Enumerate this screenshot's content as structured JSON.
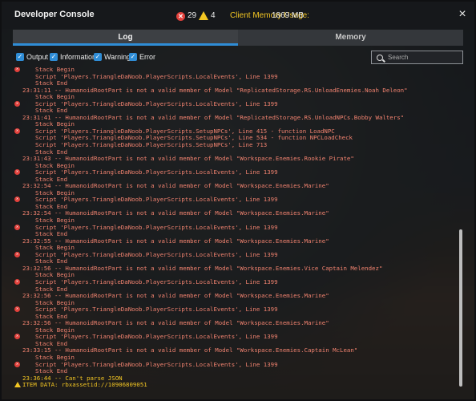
{
  "window": {
    "title": "Developer Console",
    "error_count": "29",
    "warning_count": "4",
    "memory_label": "Client Memory Usage:",
    "memory_value": "1869 MB",
    "close_glyph": "×"
  },
  "tabs": [
    {
      "label": "Log",
      "active": true
    },
    {
      "label": "Memory",
      "active": false
    }
  ],
  "filters": [
    {
      "label": "Output",
      "checked": true
    },
    {
      "label": "Information",
      "checked": true
    },
    {
      "label": "Warning",
      "checked": true
    },
    {
      "label": "Error",
      "checked": true
    }
  ],
  "search": {
    "placeholder": "Search",
    "value": ""
  },
  "colors": {
    "error": "#f0826f",
    "warning": "#f3c623",
    "accent": "#2f8dd6"
  },
  "log_lines": [
    {
      "type": "error",
      "icon": true,
      "indent": true,
      "text": "Stack Begin"
    },
    {
      "type": "error",
      "icon": false,
      "indent": true,
      "text": "Script 'Players.TriangleDaNoob.PlayerScripts.LocalEvents', Line 1399"
    },
    {
      "type": "error",
      "icon": false,
      "indent": true,
      "text": "Stack End"
    },
    {
      "type": "error",
      "icon": false,
      "indent": false,
      "text": "23:31:11 -- HumanoidRootPart is not a valid member of Model \"ReplicatedStorage.RS.UnloadEnemies.Noah Deleon\""
    },
    {
      "type": "error",
      "icon": false,
      "indent": true,
      "text": "Stack Begin"
    },
    {
      "type": "error",
      "icon": true,
      "indent": true,
      "text": "Script 'Players.TriangleDaNoob.PlayerScripts.LocalEvents', Line 1399"
    },
    {
      "type": "error",
      "icon": false,
      "indent": true,
      "text": "Stack End"
    },
    {
      "type": "error",
      "icon": false,
      "indent": false,
      "text": "23:31:41 -- HumanoidRootPart is not a valid member of Model \"ReplicatedStorage.RS.UnloadNPCs.Bobby Walters\""
    },
    {
      "type": "error",
      "icon": false,
      "indent": true,
      "text": "Stack Begin"
    },
    {
      "type": "error",
      "icon": true,
      "indent": true,
      "text": "Script 'Players.TriangleDaNoob.PlayerScripts.SetupNPCs', Line 415 - function LoadNPC"
    },
    {
      "type": "error",
      "icon": false,
      "indent": true,
      "text": "Script 'Players.TriangleDaNoob.PlayerScripts.SetupNPCs', Line 534 - function NPCLoadCheck"
    },
    {
      "type": "error",
      "icon": false,
      "indent": true,
      "text": "Script 'Players.TriangleDaNoob.PlayerScripts.SetupNPCs', Line 713"
    },
    {
      "type": "error",
      "icon": false,
      "indent": true,
      "text": "Stack End"
    },
    {
      "type": "error",
      "icon": false,
      "indent": false,
      "text": "23:31:43 -- HumanoidRootPart is not a valid member of Model \"Workspace.Enemies.Rookie Pirate\""
    },
    {
      "type": "error",
      "icon": false,
      "indent": true,
      "text": "Stack Begin"
    },
    {
      "type": "error",
      "icon": true,
      "indent": true,
      "text": "Script 'Players.TriangleDaNoob.PlayerScripts.LocalEvents', Line 1399"
    },
    {
      "type": "error",
      "icon": false,
      "indent": true,
      "text": "Stack End"
    },
    {
      "type": "error",
      "icon": false,
      "indent": false,
      "text": "23:32:54 -- HumanoidRootPart is not a valid member of Model \"Workspace.Enemies.Marine\""
    },
    {
      "type": "error",
      "icon": false,
      "indent": true,
      "text": "Stack Begin"
    },
    {
      "type": "error",
      "icon": true,
      "indent": true,
      "text": "Script 'Players.TriangleDaNoob.PlayerScripts.LocalEvents', Line 1399"
    },
    {
      "type": "error",
      "icon": false,
      "indent": true,
      "text": "Stack End"
    },
    {
      "type": "error",
      "icon": false,
      "indent": false,
      "text": "23:32:54 -- HumanoidRootPart is not a valid member of Model \"Workspace.Enemies.Marine\""
    },
    {
      "type": "error",
      "icon": false,
      "indent": true,
      "text": "Stack Begin"
    },
    {
      "type": "error",
      "icon": true,
      "indent": true,
      "text": "Script 'Players.TriangleDaNoob.PlayerScripts.LocalEvents', Line 1399"
    },
    {
      "type": "error",
      "icon": false,
      "indent": true,
      "text": "Stack End"
    },
    {
      "type": "error",
      "icon": false,
      "indent": false,
      "text": "23:32:55 -- HumanoidRootPart is not a valid member of Model \"Workspace.Enemies.Marine\""
    },
    {
      "type": "error",
      "icon": false,
      "indent": true,
      "text": "Stack Begin"
    },
    {
      "type": "error",
      "icon": true,
      "indent": true,
      "text": "Script 'Players.TriangleDaNoob.PlayerScripts.LocalEvents', Line 1399"
    },
    {
      "type": "error",
      "icon": false,
      "indent": true,
      "text": "Stack End"
    },
    {
      "type": "error",
      "icon": false,
      "indent": false,
      "text": "23:32:56 -- HumanoidRootPart is not a valid member of Model \"Workspace.Enemies.Vice Captain Melendez\""
    },
    {
      "type": "error",
      "icon": false,
      "indent": true,
      "text": "Stack Begin"
    },
    {
      "type": "error",
      "icon": true,
      "indent": true,
      "text": "Script 'Players.TriangleDaNoob.PlayerScripts.LocalEvents', Line 1399"
    },
    {
      "type": "error",
      "icon": false,
      "indent": true,
      "text": "Stack End"
    },
    {
      "type": "error",
      "icon": false,
      "indent": false,
      "text": "23:32:56 -- HumanoidRootPart is not a valid member of Model \"Workspace.Enemies.Marine\""
    },
    {
      "type": "error",
      "icon": false,
      "indent": true,
      "text": "Stack Begin"
    },
    {
      "type": "error",
      "icon": true,
      "indent": true,
      "text": "Script 'Players.TriangleDaNoob.PlayerScripts.LocalEvents', Line 1399"
    },
    {
      "type": "error",
      "icon": false,
      "indent": true,
      "text": "Stack End"
    },
    {
      "type": "error",
      "icon": false,
      "indent": false,
      "text": "23:32:56 -- HumanoidRootPart is not a valid member of Model \"Workspace.Enemies.Marine\""
    },
    {
      "type": "error",
      "icon": false,
      "indent": true,
      "text": "Stack Begin"
    },
    {
      "type": "error",
      "icon": true,
      "indent": true,
      "text": "Script 'Players.TriangleDaNoob.PlayerScripts.LocalEvents', Line 1399"
    },
    {
      "type": "error",
      "icon": false,
      "indent": true,
      "text": "Stack End"
    },
    {
      "type": "error",
      "icon": false,
      "indent": false,
      "text": "23:33:15 -- HumanoidRootPart is not a valid member of Model \"Workspace.Enemies.Captain McLean\""
    },
    {
      "type": "error",
      "icon": false,
      "indent": true,
      "text": "Stack Begin"
    },
    {
      "type": "error",
      "icon": true,
      "indent": true,
      "text": "Script 'Players.TriangleDaNoob.PlayerScripts.LocalEvents', Line 1399"
    },
    {
      "type": "error",
      "icon": false,
      "indent": true,
      "text": "Stack End"
    },
    {
      "type": "warning",
      "icon": false,
      "indent": false,
      "text": "23:36:44 -- Can't parse JSON"
    },
    {
      "type": "warning",
      "icon": true,
      "indent": false,
      "text": "ITEM DATA: rbxassetid://10906809051"
    }
  ]
}
